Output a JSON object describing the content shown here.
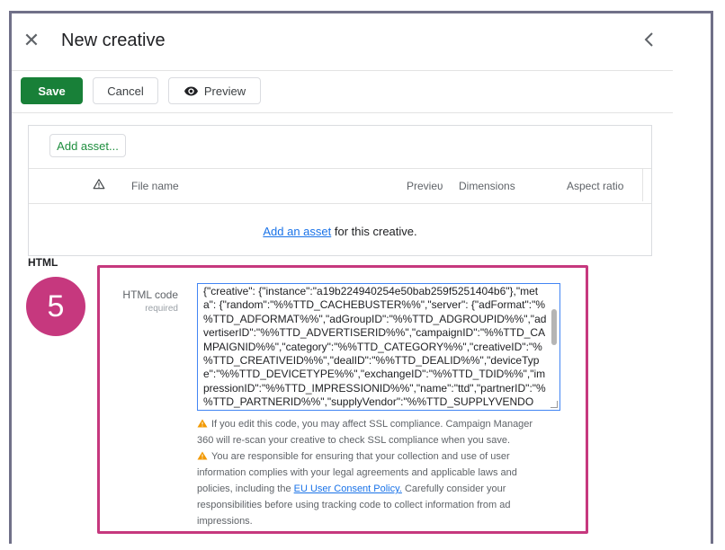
{
  "header": {
    "title": "New creative"
  },
  "toolbar": {
    "save_label": "Save",
    "cancel_label": "Cancel",
    "preview_label": "Preview"
  },
  "assets": {
    "add_button": "Add asset...",
    "columns": [
      "File name",
      "Previeʋ",
      "Dimensions",
      "Aspect ratio"
    ],
    "empty_link": "Add an asset",
    "empty_text": "for this creative."
  },
  "html_section": {
    "section_title": "HTML",
    "step_number": "5",
    "field_label": "HTML code",
    "field_sub": "required",
    "code": "{\"creative\": {\"instance\":\"a19b224940254e50bab259f5251404b6\"},\"meta\": {\"random\":\"%%TTD_CACHEBUSTER%%\",\"server\": {\"adFormat\":\"%%TTD_ADFORMAT%%\",\"adGroupID\":\"%%TTD_ADGROUPID%%\",\"advertiserID\":\"%%TTD_ADVERTISERID%%\",\"campaignID\":\"%%TTD_CAMPAIGNID%%\",\"category\":\"%%TTD_CATEGORY%%\",\"creativeID\":\"%%TTD_CREATIVEID%%\",\"dealID\":\"%%TTD_DEALID%%\",\"deviceType\":\"%%TTD_DEVICETYPE%%\",\"exchangeID\":\"%%TTD_TDID%%\",\"impressionID\":\"%%TTD_IMPRESSIONID%%\",\"name\":\"ttd\",\"partnerID\":\"%%TTD_PARTNERID%%\",\"supplyVendor\":\"%%TTD_SUPPLYVENDOR%%\",\"url\":\"%",
    "note1": "If you edit this code, you may affect SSL compliance. Campaign Manager 360 will re-scan your creative to check SSL compliance when you save.",
    "note2_a": "You are responsible for ensuring that your collection and use of user information complies with your legal agreements and applicable laws and policies, including the",
    "note2_link": "EU User Consent Policy.",
    "note2_b": "Carefully consider your responsibilities before using tracking code to collect information from ad impressions."
  },
  "colors": {
    "save_green": "#188038",
    "highlight_magenta": "#c6387e",
    "link_blue": "#1a73e8",
    "warning_orange": "#f29900"
  },
  "icons": [
    "close-icon",
    "chevron-left-icon",
    "eye-icon",
    "warning-icon"
  ]
}
